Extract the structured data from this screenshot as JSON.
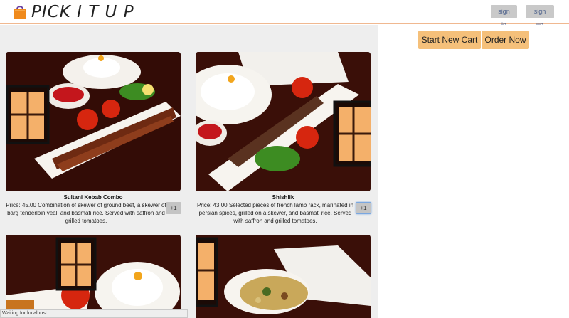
{
  "header": {
    "logo_text": "PICK I T U P",
    "signin_label": "sign in",
    "signup_label": "sign up"
  },
  "cart": {
    "new_cart_label": "Start New Cart",
    "order_label": "Order Now"
  },
  "menu_items": [
    {
      "name": "Sultani Kebab Combo",
      "description": "Price: 45.00 Combination of skewer of ground beef, a skewer of barg tenderloin veal, and basmati rice. Served with saffron and grilled tomatoes.",
      "add_label": "+1"
    },
    {
      "name": "Shishlik",
      "description": "Price: 43.00 Selected pieces of french lamb rack, marinated in persian spices, grilled on a skewer, and basmati rice. Served with saffron and grilled tomatoes.",
      "add_label": "+1"
    }
  ],
  "status_bar": {
    "text": "Waiting for localhost..."
  },
  "colors": {
    "accent": "#f5c07a",
    "auth_button": "#c9c9c9",
    "auth_text": "#4a5f8a",
    "menu_background": "#eeeeee"
  },
  "icons": {
    "logo": "shopping-bag-icon"
  }
}
